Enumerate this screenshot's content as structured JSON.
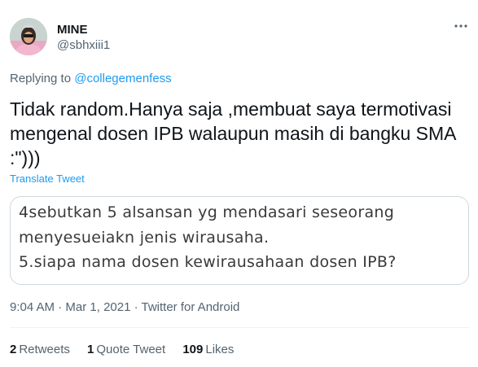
{
  "author": {
    "display_name": "MINE",
    "handle": "@sbhxiii1"
  },
  "reply": {
    "prefix": "Replying to",
    "mention": "@collegemenfess"
  },
  "tweet": {
    "lines": [
      "Tidak random.Hanya saja ,membuat saya termotivasi",
      "mengenal dosen IPB walaupun masih di bangku SMA",
      ":\")))"
    ],
    "translate_label": "Translate Tweet"
  },
  "quote_image": {
    "lines": [
      "4sebutkan 5 alsansan yg mendasari seseorang",
      "menyesueiakn jenis wirausaha.",
      "5.siapa nama dosen kewirausahaan dosen IPB?"
    ]
  },
  "meta": {
    "time": "9:04 AM",
    "separator": " · ",
    "date": "Mar 1, 2021",
    "source": "Twitter for Android"
  },
  "stats": {
    "retweets_count": "2",
    "retweets_label": "Retweets",
    "quotes_count": "1",
    "quotes_label": "Quote Tweet",
    "likes_count": "109",
    "likes_label": "Likes"
  },
  "icons": {
    "more": "more-horizontal-icon",
    "avatar": "profile-avatar"
  },
  "colors": {
    "accent": "#1d9bf0",
    "text_primary": "#0f1419",
    "text_secondary": "#536471",
    "border": "#cfd9de"
  }
}
